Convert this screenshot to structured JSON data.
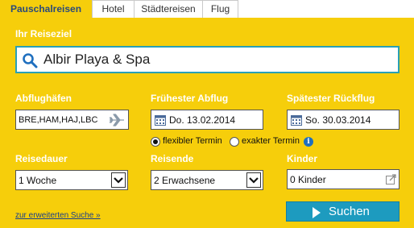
{
  "tabs": [
    {
      "label": "Pauschalreisen",
      "active": true
    },
    {
      "label": "Hotel",
      "active": false
    },
    {
      "label": "Städtereisen",
      "active": false
    },
    {
      "label": "Flug",
      "active": false
    }
  ],
  "destination": {
    "label": "Ihr Reiseziel",
    "value": "Albir Playa & Spa",
    "icon": "search-icon"
  },
  "airports": {
    "label": "Abflughäfen",
    "value": "BRE,HAM,HAJ,LBC",
    "icon": "airplane-icon"
  },
  "earliest_departure": {
    "label": "Frühester Abflug",
    "value": "Do. 13.02.2014",
    "icon": "calendar-icon"
  },
  "latest_return": {
    "label": "Spätester Rückflug",
    "value": "So. 30.03.2014",
    "icon": "calendar-icon"
  },
  "date_mode": {
    "options": [
      {
        "label": "flexibler Termin",
        "selected": true
      },
      {
        "label": "exakter Termin",
        "selected": false
      }
    ],
    "info_icon": "info-icon"
  },
  "duration": {
    "label": "Reisedauer",
    "value": "1 Woche"
  },
  "travellers": {
    "label": "Reisende",
    "value": "2 Erwachsene"
  },
  "children": {
    "label": "Kinder",
    "value": "0 Kinder",
    "icon": "external-popup-icon"
  },
  "advanced_link": "zur erweiterten Suche »",
  "search_button": "Suchen",
  "colors": {
    "panel": "#f6ce0b",
    "accent": "#1d9bbf",
    "tab_active_text": "#2a4a7a",
    "link": "#1a3f8a"
  }
}
